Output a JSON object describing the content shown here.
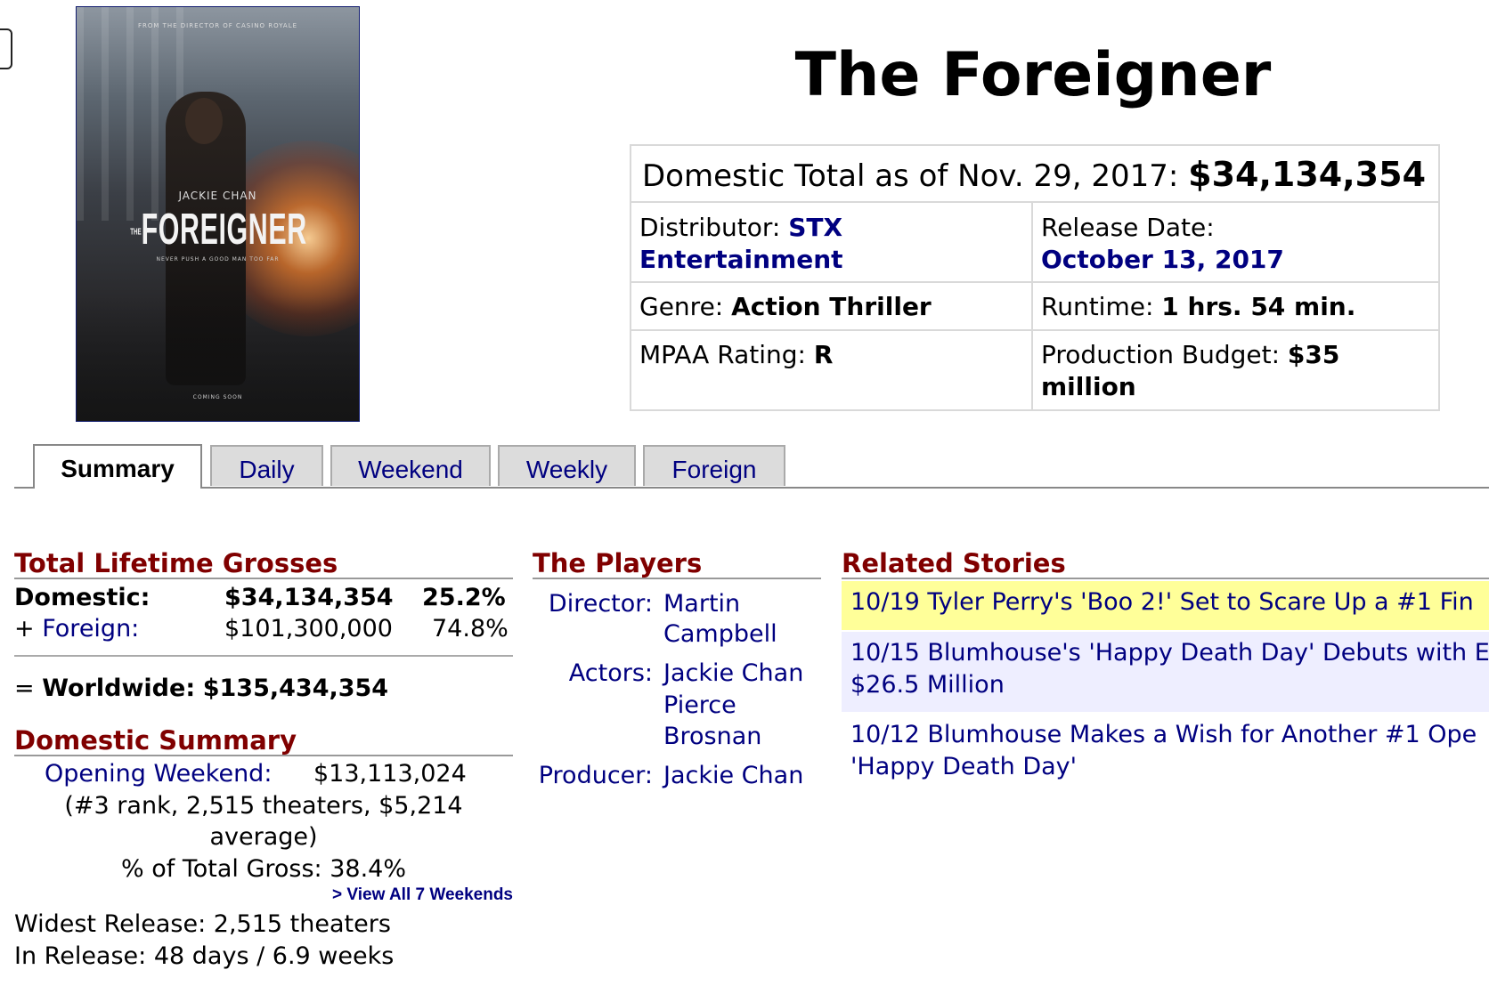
{
  "poster": {
    "top_tag": "FROM THE DIRECTOR OF CASINO ROYALE",
    "actor": "JACKIE CHAN",
    "title": "FOREIGNER",
    "title_prefix": "THE",
    "tagline": "NEVER PUSH A GOOD MAN TOO FAR",
    "coming": "COMING SOON"
  },
  "movie_title": "The Foreigner",
  "info": {
    "domestic_label": "Domestic Total as of Nov. 29, 2017:",
    "domestic_value": "$34,134,354",
    "distributor_label": "Distributor:",
    "distributor_value_1": "STX",
    "distributor_value_2": "Entertainment",
    "release_label": "Release Date:",
    "release_value": "October 13, 2017",
    "genre_label": "Genre:",
    "genre_value": "Action Thriller",
    "runtime_label": "Runtime:",
    "runtime_value": "1 hrs. 54 min.",
    "mpaa_label": "MPAA Rating:",
    "mpaa_value": "R",
    "budget_label": "Production Budget:",
    "budget_value_1": "$35",
    "budget_value_2": "million"
  },
  "tabs": [
    "Summary",
    "Daily",
    "Weekend",
    "Weekly",
    "Foreign"
  ],
  "grosses": {
    "heading": "Total Lifetime Grosses",
    "domestic_label": "Domestic:",
    "domestic_value": "$34,134,354",
    "domestic_pct": "25.2%",
    "foreign_prefix": "+",
    "foreign_label": "Foreign:",
    "foreign_value": "$101,300,000",
    "foreign_pct": "74.8%",
    "worldwide_prefix": "=",
    "worldwide_label": "Worldwide:",
    "worldwide_value": "$135,434,354"
  },
  "dom_summary": {
    "heading": "Domestic Summary",
    "opening_label": "Opening Weekend:",
    "opening_value": "$13,113,024",
    "opening_detail_1": "(#3 rank, 2,515 theaters, $5,214",
    "opening_detail_2": "average)",
    "pct_label": "% of Total Gross:",
    "pct_value": "38.4%",
    "view_all": "> View All 7 Weekends",
    "widest_label": "Widest Release:",
    "widest_value": "2,515 theaters",
    "inrelease_label": "In Release:",
    "inrelease_value": "48 days / 6.9 weeks"
  },
  "players": {
    "heading": "The Players",
    "director_label": "Director:",
    "director_1": "Martin",
    "director_2": "Campbell",
    "actors_label": "Actors:",
    "actor_1": "Jackie Chan",
    "actor_2a": "Pierce",
    "actor_2b": "Brosnan",
    "producer_label": "Producer:",
    "producer": "Jackie Chan"
  },
  "stories": {
    "heading": "Related Stories",
    "items": [
      {
        "line1": "10/19 Tyler Perry's 'Boo 2!' Set to Scare Up a #1 Fin",
        "line2": ""
      },
      {
        "line1": "10/15 Blumhouse's 'Happy Death Day' Debuts with E",
        "line2": "$26.5 Million"
      },
      {
        "line1": "10/12 Blumhouse Makes a Wish for Another #1 Ope",
        "line2": "'Happy Death Day'"
      }
    ],
    "highlight_color": "#ffff99",
    "alt_color": "#eeeeff"
  }
}
